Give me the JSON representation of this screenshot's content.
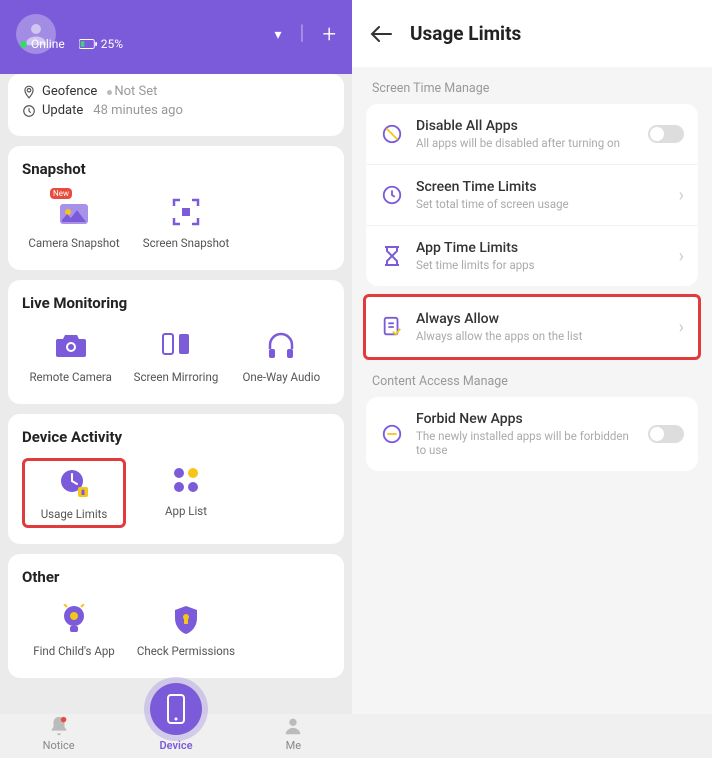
{
  "header": {
    "status_online": "Online",
    "battery_pct": "25%"
  },
  "status_card": {
    "geofence_label": "Geofence",
    "geofence_status": "Not Set",
    "update_label": "Update",
    "update_time": "48 minutes ago"
  },
  "sections": {
    "snapshot": {
      "title": "Snapshot",
      "items": [
        "Camera Snapshot",
        "Screen Snapshot"
      ]
    },
    "live": {
      "title": "Live Monitoring",
      "items": [
        "Remote Camera",
        "Screen Mirroring",
        "One-Way Audio"
      ]
    },
    "activity": {
      "title": "Device Activity",
      "items": [
        "Usage Limits",
        "App List"
      ]
    },
    "other": {
      "title": "Other",
      "items": [
        "Find Child's App",
        "Check Permissions"
      ]
    }
  },
  "nav": {
    "notice": "Notice",
    "device": "Device",
    "me": "Me"
  },
  "right": {
    "title": "Usage Limits",
    "section1": "Screen Time Manage",
    "section2": "Content Access Manage",
    "rows": {
      "disable": {
        "title": "Disable All Apps",
        "sub": "All apps will be disabled after turning on"
      },
      "screentime": {
        "title": "Screen Time Limits",
        "sub": "Set total time of screen usage"
      },
      "apptime": {
        "title": "App Time Limits",
        "sub": "Set time limits for apps"
      },
      "always": {
        "title": "Always Allow",
        "sub": "Always allow the apps on the list"
      },
      "forbid": {
        "title": "Forbid New Apps",
        "sub": "The newly installed apps will be forbidden to use"
      }
    }
  },
  "badge_new": "New"
}
